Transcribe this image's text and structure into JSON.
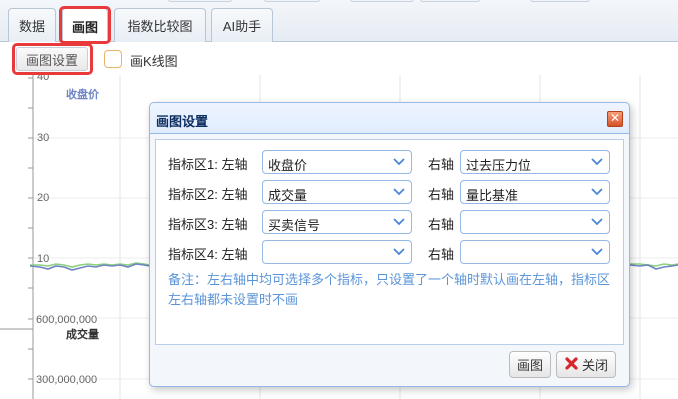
{
  "tabs": [
    {
      "label": "数据",
      "active": false
    },
    {
      "label": "画图",
      "active": true
    },
    {
      "label": "指数比较图",
      "active": false
    },
    {
      "label": "AI助手",
      "active": false
    }
  ],
  "toolbar": {
    "settings_button": "画图设置",
    "kline_checkbox_label": "画K线图",
    "kline_checked": false
  },
  "chart": {
    "price_title": "收盘价",
    "price_ticks": [
      "40",
      "30",
      "20",
      "10"
    ],
    "volume_title": "成交量",
    "volume_ticks": [
      "600,000,000",
      "300,000,000"
    ],
    "colors": {
      "price_line_1": "#6e84c4",
      "price_line_2": "#8ccf7e",
      "title": "#6e84c4"
    }
  },
  "dialog": {
    "title": "画图设置",
    "rows": [
      {
        "label": "指标区1: 左轴",
        "left_value": "收盘价",
        "right_label": "右轴",
        "right_value": "过去压力位"
      },
      {
        "label": "指标区2: 左轴",
        "left_value": "成交量",
        "right_label": "右轴",
        "right_value": "量比基准"
      },
      {
        "label": "指标区3: 左轴",
        "left_value": "买卖信号",
        "right_label": "右轴",
        "right_value": ""
      },
      {
        "label": "指标区4: 左轴",
        "left_value": "",
        "right_label": "右轴",
        "right_value": ""
      }
    ],
    "note": "备注：左右轴中均可选择多个指标，只设置了一个轴时默认画在左轴，指标区左右轴都未设置时不画",
    "draw_button": "画图",
    "close_button": "关闭"
  }
}
